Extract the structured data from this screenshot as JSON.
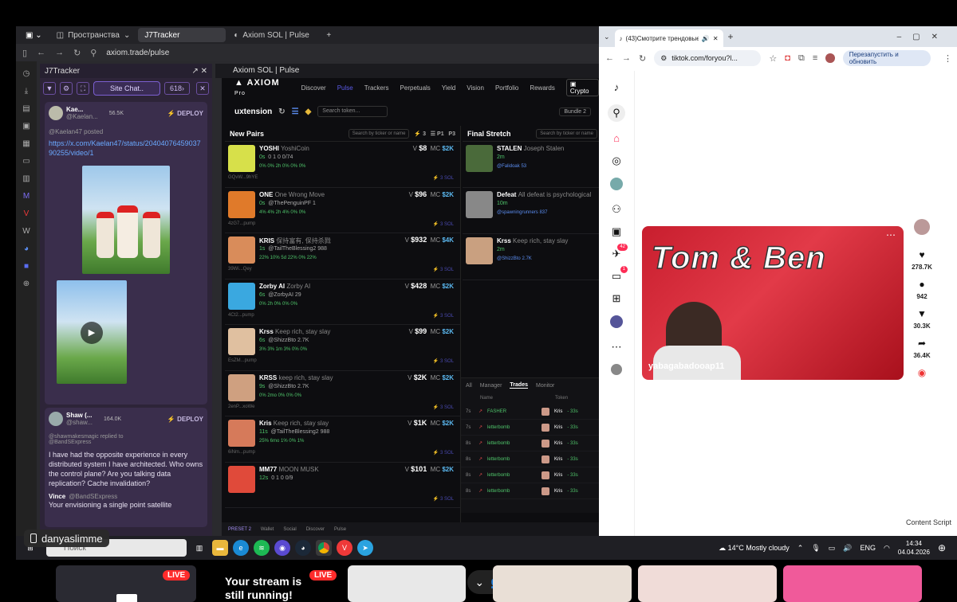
{
  "vivaldi": {
    "tabs": [
      "Пространства",
      "J7Tracker",
      "Axiom SOL | Pulse"
    ],
    "url": "axiom.trade/pulse"
  },
  "j7": {
    "title": "J7Tracker",
    "site_chat": "Site Chat..",
    "count": "618",
    "card1": {
      "name": "Kae...",
      "handle": "@Kaelan...",
      "mc": "56.5K",
      "deploy": "DEPLOY",
      "posted": "@Kaelan47 posted",
      "link": "https://x.com/Kaelan47/status/2040407645903790255/video/1"
    },
    "card2": {
      "name": "Shaw (...",
      "handle": "@shaw...",
      "mc": "164.0K",
      "deploy": "DEPLOY",
      "reply": "@shawmakesmagic replied to @BandSExpress",
      "text": "I have had the opposite experience in every distributed system I have architected. Who owns the control plane? Are you talking data replication? Cache invalidation?",
      "quoted_name": "Vince",
      "quoted_handle": "@BandSExpress",
      "quoted_text": "Your envisioning a single point satellite"
    }
  },
  "axiom": {
    "window_title": "Axiom SOL | Pulse",
    "logo": "AXIOM",
    "logo_sub": "Pro",
    "nav": [
      "Discover",
      "Pulse",
      "Trackers",
      "Perpetuals",
      "Yield",
      "Vision",
      "Portfolio",
      "Rewards"
    ],
    "crypto": "Crypto",
    "extension": "uxtension",
    "search_placeholder": "Search token...",
    "bundle": "Bundle 2",
    "new_pairs": "New Pairs",
    "final_stretch": "Final Stretch",
    "col_search": "Search by ticker or name",
    "pairs": [
      {
        "name": "YOSHI",
        "full": "YoshiCoin",
        "age": "0s",
        "addr": "GQvW...9hYE",
        "v": "$8",
        "mc": "$2K",
        "l2": "0 1 0 0/74",
        "l3": "0% 0% 2h 0% 0% 0%"
      },
      {
        "name": "ONE",
        "full": "One Wrong Move",
        "age": "0s",
        "addr": "4zG7...pump",
        "v": "$96",
        "mc": "$2K",
        "l2": "@ThePenguinPF 1",
        "l3": "4% 4% 2h 4% 0% 0%"
      },
      {
        "name": "KRIS",
        "full": "保持富有, 保持杀戮",
        "age": "1s",
        "addr": "39Wi...Qey",
        "v": "$932",
        "mc": "$4K",
        "l2": "@TailTheBlessing2 988",
        "l3": "22% 10% 5d 22% 0% 22%"
      },
      {
        "name": "Zorby AI",
        "full": "Zorby AI",
        "age": "6s",
        "addr": "4Ct2...pump",
        "v": "$428",
        "mc": "$2K",
        "l2": "@ZorbyAI 29",
        "l3": "0% 2h 0% 0% 0%"
      },
      {
        "name": "Krss",
        "full": "Keep rich, stay slay",
        "age": "6s",
        "addr": "EsZM...pump",
        "v": "$99",
        "mc": "$2K",
        "l2": "@ShizzBto 2.7K",
        "l3": "3% 3% 1m 3% 0% 0%"
      },
      {
        "name": "KRSS",
        "full": "keep rich, stay slay",
        "age": "9s",
        "addr": "2enP...xoWe",
        "v": "$2K",
        "mc": "$2K",
        "l2": "@ShizzBto 2.7K",
        "l3": "0% 2mo 0% 0% 0%"
      },
      {
        "name": "Kris",
        "full": "Keep rich, stay slay",
        "age": "11s",
        "addr": "6iNm...pump",
        "v": "$1K",
        "mc": "$2K",
        "l2": "@TailTheBlessing2 988",
        "l3": "25% 6mo 1% 0% 1%"
      },
      {
        "name": "MM77",
        "full": "MOON MUSK",
        "age": "12s",
        "addr": "",
        "v": "$101",
        "mc": "$2K",
        "l2": "0 1 0 0/9",
        "l3": ""
      }
    ],
    "final": [
      {
        "name": "STALEN",
        "full": "Joseph Stalen",
        "age": "2m",
        "handle": "@Falidoak",
        "f": "53"
      },
      {
        "name": "Defeat",
        "full": "All defeat is psychological",
        "age": "10m",
        "handle": "@spawningrunners",
        "f": "837"
      },
      {
        "name": "Krss",
        "full": "Keep rich, stay slay",
        "age": "2m",
        "handle": "@ShizzBto",
        "f": "2.7K"
      }
    ],
    "tabs": [
      "All",
      "Manager",
      "Trades",
      "Monitor"
    ],
    "trades_head": [
      "Name",
      "Token"
    ],
    "trades": [
      {
        "age": "7s",
        "name": "FASHER",
        "token": "Kris",
        "ago": "33s"
      },
      {
        "age": "7s",
        "name": "letterbomb",
        "token": "Kris",
        "ago": "33s"
      },
      {
        "age": "8s",
        "name": "letterbomb",
        "token": "Kris",
        "ago": "33s"
      },
      {
        "age": "8s",
        "name": "letterbomb",
        "token": "Kris",
        "ago": "33s"
      },
      {
        "age": "8s",
        "name": "letterbomb",
        "token": "Kris",
        "ago": "33s"
      },
      {
        "age": "8s",
        "name": "letterbomb",
        "token": "Kris",
        "ago": "33s"
      }
    ],
    "bottom": [
      "PRESET 2",
      "Wallet",
      "Social",
      "Discover",
      "Pulse"
    ]
  },
  "chrome": {
    "tab_title": "(43)Смотрите трендовые",
    "url": "tiktok.com/foryou?l...",
    "relaunch": "Перезапустить и обновить",
    "messages_badge": "42",
    "inbox_badge": "1",
    "video_title": "Tom & Ben",
    "video_author": "yabagabadooap11",
    "likes": "278.7K",
    "comments": "942",
    "saves": "30.3K",
    "shares": "36.4K",
    "content_script": "Content Script"
  },
  "taskbar": {
    "search": "Поиск",
    "weather": "14°C  Mostly cloudy",
    "lang": "ENG",
    "time": "14:34",
    "date": "04.04.2026"
  },
  "overlay": {
    "username": "danyaslimme",
    "stream_text": "Your stream is still running!",
    "live": "LIVE"
  }
}
